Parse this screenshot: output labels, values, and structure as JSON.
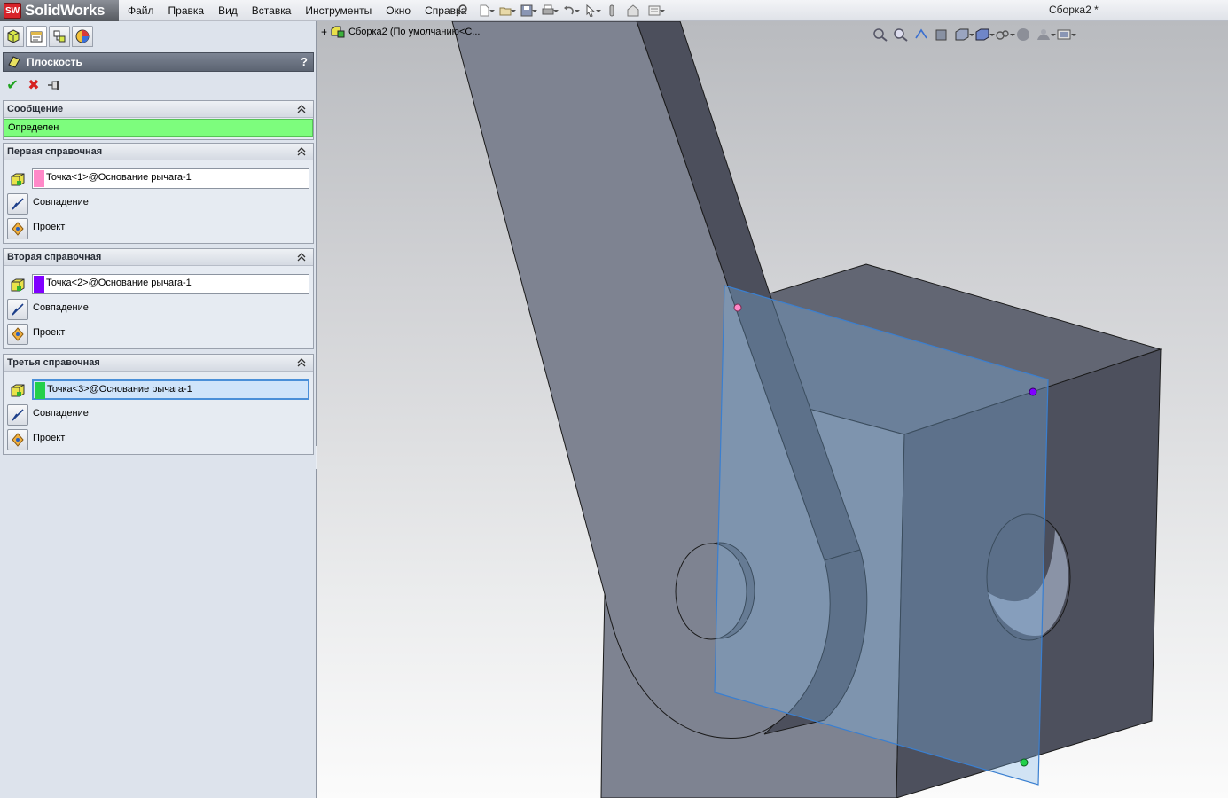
{
  "app": {
    "logo_mark": "SW",
    "logo_text": "SolidWorks",
    "document_title": "Сборка2 *"
  },
  "menu": [
    "Файл",
    "Правка",
    "Вид",
    "Вставка",
    "Инструменты",
    "Окно",
    "Справка"
  ],
  "quick_toolbar": [
    "new-document-icon",
    "open-icon",
    "save-icon",
    "print-icon",
    "undo-icon",
    "select-icon",
    "rebuild-icon",
    "file-properties-icon",
    "options-icon"
  ],
  "property_manager": {
    "tabs": [
      "featuremanager-tab-icon",
      "propertymanager-tab-icon",
      "configuration-manager-tab-icon",
      "display-manager-tab-icon"
    ],
    "title": "Плоскость",
    "help": "?",
    "actions": {
      "ok": "✔",
      "cancel": "✖",
      "pin": "pushpin-icon"
    },
    "message_group": {
      "title": "Сообщение",
      "text": "Определен"
    },
    "references": [
      {
        "title": "Первая справочная",
        "value": "Точка<1>@Основание рычага-1",
        "color": "#ff88c8",
        "options": [
          "Совпадение",
          "Проект"
        ],
        "active": false
      },
      {
        "title": "Вторая справочная",
        "value": "Точка<2>@Основание рычага-1",
        "color": "#8000ff",
        "options": [
          "Совпадение",
          "Проект"
        ],
        "active": false
      },
      {
        "title": "Третья справочная",
        "value": "Точка<3>@Основание рычага-1",
        "color": "#22d04a",
        "options": [
          "Совпадение",
          "Проект"
        ],
        "active": true
      }
    ]
  },
  "viewport": {
    "tree_root": "Сборка2  (По умолчанию<С...",
    "view_tools": [
      "zoom-to-fit-icon",
      "zoom-to-area-icon",
      "previous-view-icon",
      "section-view-icon",
      "view-orientation-icon",
      "display-style-icon",
      "hide-show-items-icon",
      "edit-appearance-icon",
      "apply-scene-icon",
      "view-settings-icon"
    ],
    "colors": {
      "body_light": "#7e8391",
      "body_mid": "#626673",
      "body_dark": "#4c4f5c",
      "plane": "#7fb6ea",
      "plane_edge": "#3a7fd0",
      "point1": "#ff88c8",
      "point2": "#8000ff",
      "point3": "#22d04a"
    }
  }
}
